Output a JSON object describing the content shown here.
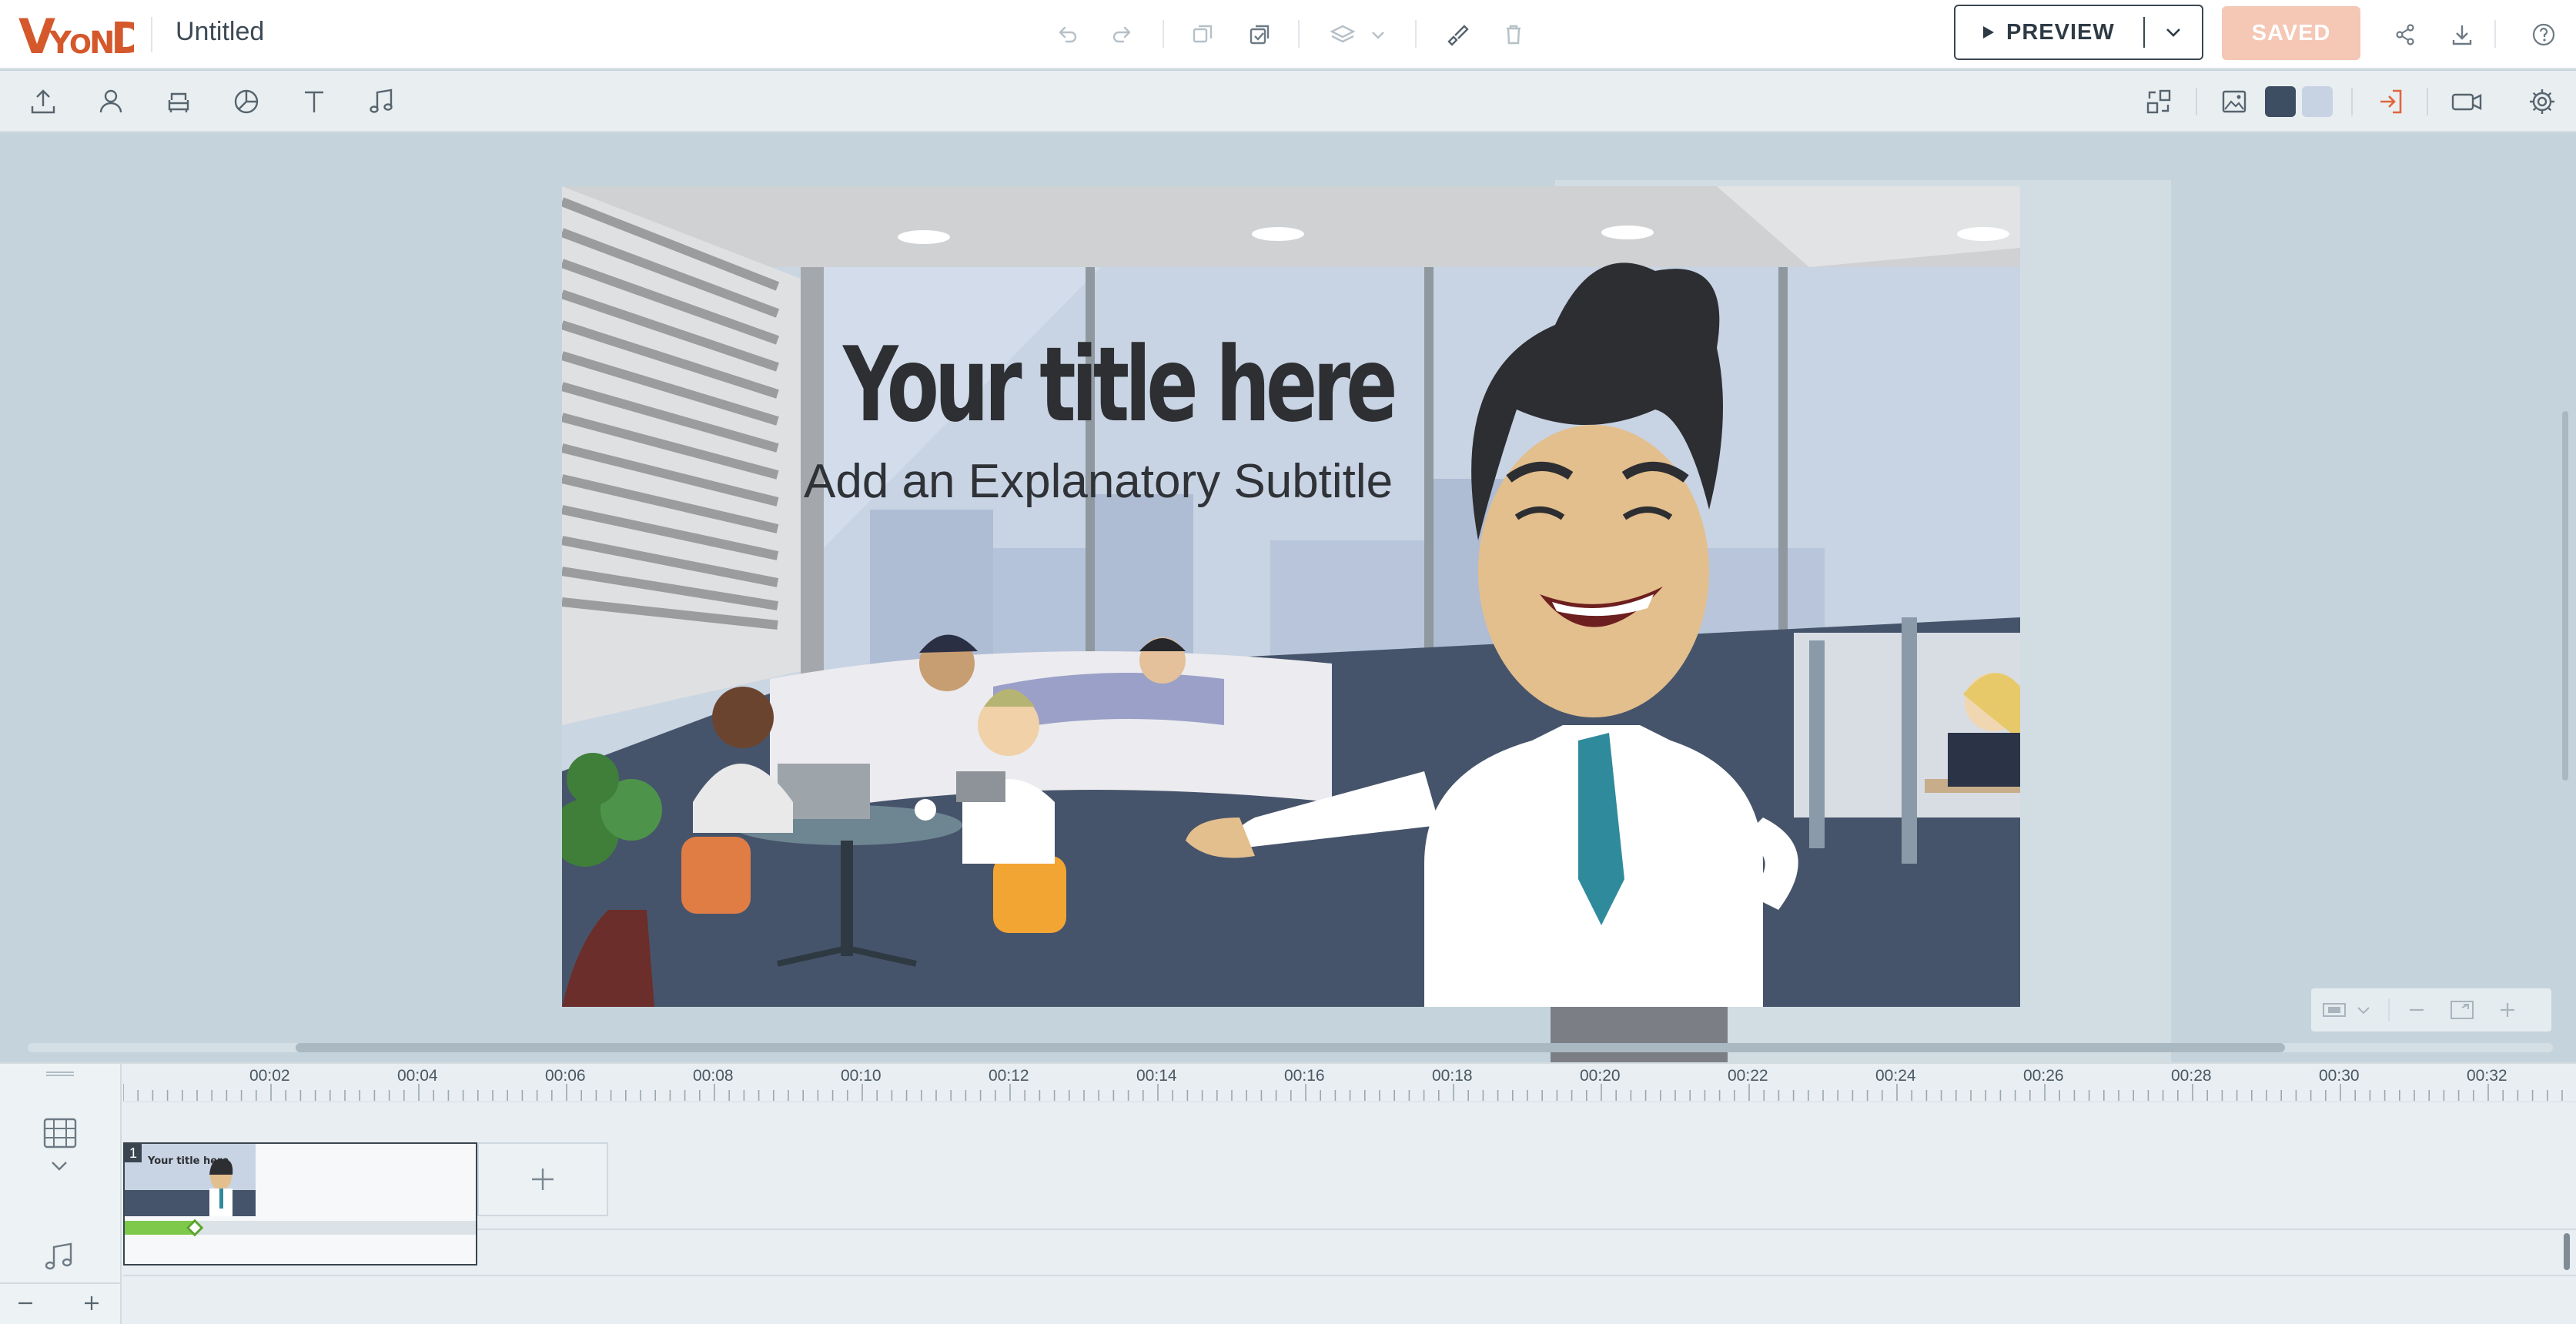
{
  "app": {
    "logo_text": "VYOND",
    "document_title": "Untitled"
  },
  "topbar": {
    "preview_label": "PREVIEW",
    "saved_label": "SAVED",
    "icons": [
      "undo-icon",
      "redo-icon",
      "duplicate-icon",
      "paste-icon",
      "layers-icon",
      "brush-icon",
      "trash-icon",
      "share-icon",
      "download-icon",
      "help-icon"
    ]
  },
  "toolbar": {
    "left_icons": [
      "upload-icon",
      "character-icon",
      "props-icon",
      "chart-icon",
      "text-icon",
      "music-icon"
    ],
    "right_icons": [
      "swap-icon",
      "background-icon",
      "enter-icon",
      "camera-icon",
      "settings-icon"
    ],
    "swatches": [
      "#3d4d62",
      "#c7d2e3"
    ]
  },
  "scene": {
    "title": "Your title here",
    "subtitle": "Add an Explanatory Subtitle"
  },
  "timeline": {
    "ticks": [
      "00:02",
      "00:04",
      "00:06",
      "00:08",
      "00:10",
      "00:12",
      "00:14",
      "00:16",
      "00:18",
      "00:20",
      "00:22",
      "00:24",
      "00:26",
      "00:28",
      "00:30",
      "00:32"
    ],
    "scene_number": "1",
    "scene_progress": 0.2
  },
  "colors": {
    "brand": "#d5582c",
    "saved_bg": "#f5c7b5",
    "accent_green": "#7ec84a",
    "stage_bg": "#c5d4dc"
  }
}
